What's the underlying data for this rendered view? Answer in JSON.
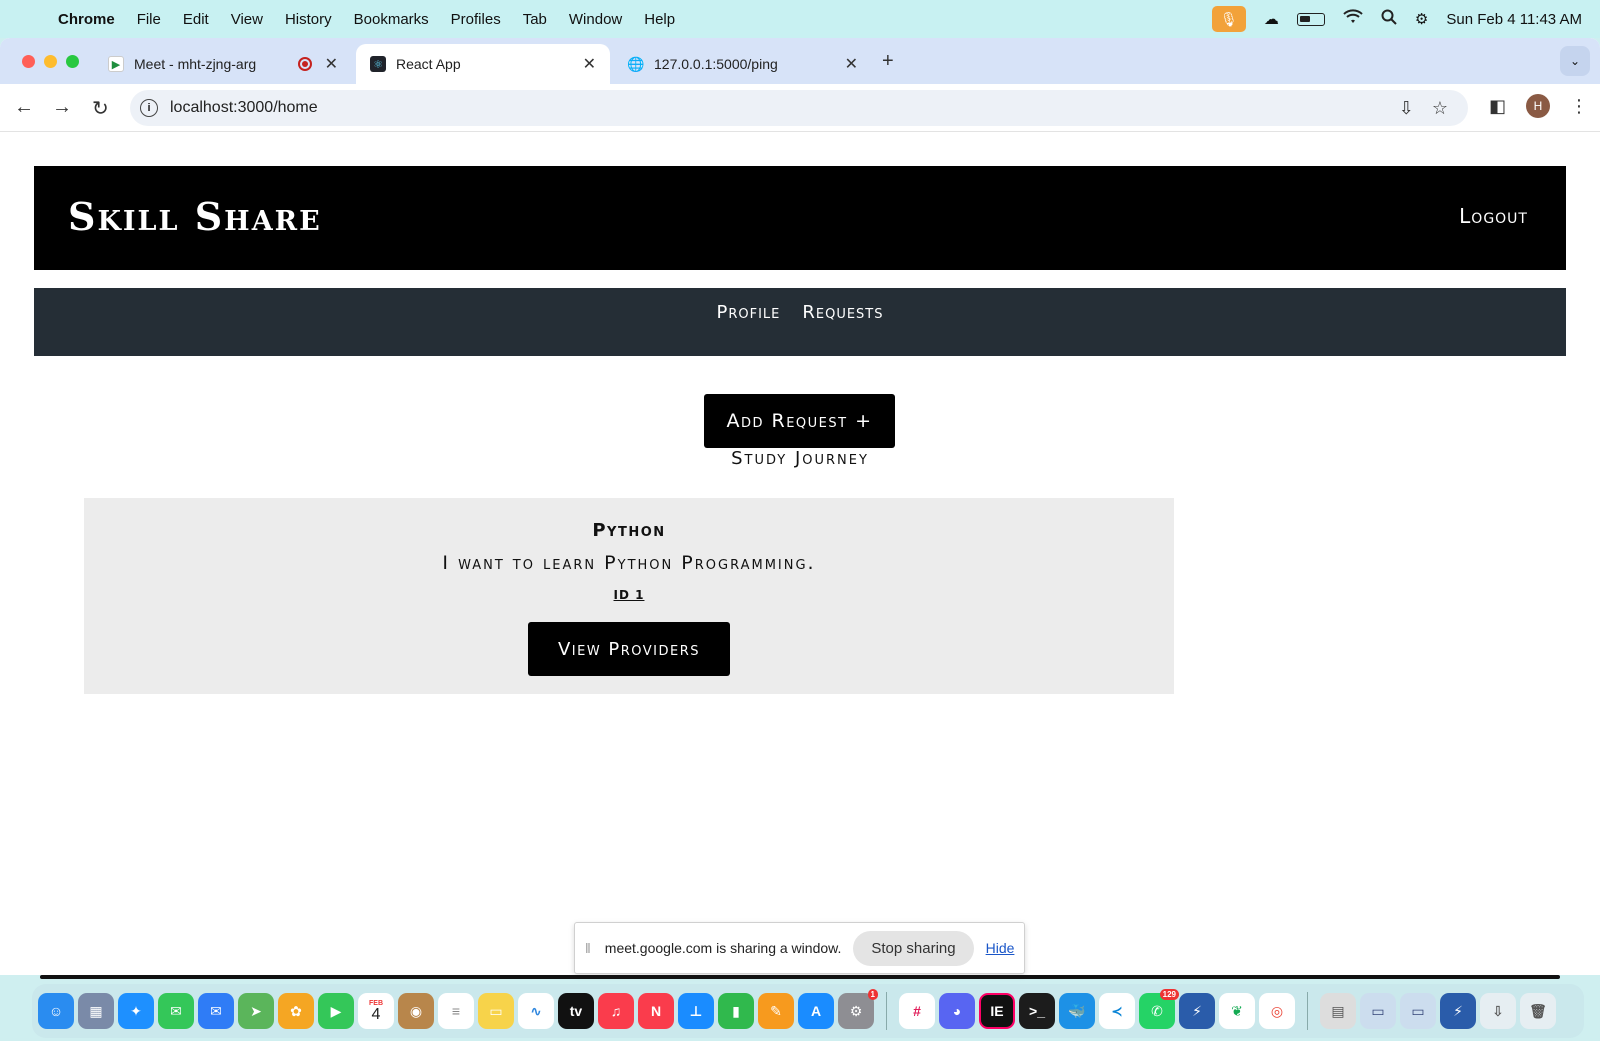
{
  "menubar": {
    "app": "Chrome",
    "items": [
      "File",
      "Edit",
      "View",
      "History",
      "Bookmarks",
      "Profiles",
      "Tab",
      "Window",
      "Help"
    ],
    "clock": "Sun Feb 4  11:43 AM"
  },
  "tabs": [
    {
      "title": "Meet - mht-zjng-arg",
      "icon": "google-meet-icon"
    },
    {
      "title": "React App",
      "icon": "react-icon"
    },
    {
      "title": "127.0.0.1:5000/ping",
      "icon": "globe-icon"
    }
  ],
  "address_bar": {
    "url": "localhost:3000/home"
  },
  "profile_initial": "H",
  "site": {
    "brand": "Skill Share",
    "logout": "Logout",
    "nav": [
      "Profile",
      "Requests"
    ],
    "add_request": "Add Request +",
    "section_title": "Study Journey"
  },
  "requests": [
    {
      "title": "Python",
      "description": "I want to learn Python Programming.",
      "id_label": "ID 1",
      "button": "View Providers"
    }
  ],
  "share_banner": {
    "message": "meet.google.com is sharing a window.",
    "stop": "Stop sharing",
    "hide": "Hide"
  },
  "dock": {
    "calendar_day": "4",
    "calendar_month": "FEB",
    "system_settings_badge": "1",
    "whatsapp_badge": "129"
  },
  "colors": {
    "header_bg": "#000000",
    "subnav_bg": "#252e36",
    "card_bg": "#ececec",
    "tabstrip_bg": "#d7e3f8"
  }
}
